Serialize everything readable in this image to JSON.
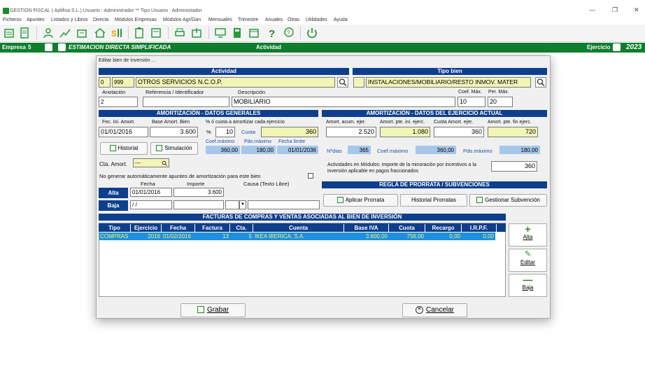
{
  "window": {
    "title": "GESTION FISCAL  ( Aplifisa S.L.)  Usuario : Administrador  **  Tipo Usuario : Administrador"
  },
  "menu": [
    "Ficheros",
    "Apuntes",
    "Listados y Libros",
    "Directa",
    "Módulos Empresas",
    "Módulos Agr/Gan",
    "Mensuales",
    "Trimestre",
    "Anuales",
    "Otras",
    "Utilidades",
    "Ayuda"
  ],
  "status": {
    "empresa_label": "Empresa",
    "empresa_num": "5",
    "regimen": "ESTIMACION DIRECTA SIMPLIFICADA",
    "estado": "Actividad",
    "ejercicio_label": "Ejercicio",
    "ejercicio": "2023"
  },
  "dialog": {
    "title": "Editar bien de Inversión ...",
    "actividad": {
      "header": "Actividad",
      "code1": "0",
      "code2": "999",
      "name": "OTROS SERVICIOS N.C.O.P."
    },
    "tipo_bien": {
      "header": "Tipo bien",
      "name": "INSTALACIONES/MOBILIARIO/RESTO INMOV. MATER"
    },
    "labels": {
      "anotacion": "Anotación",
      "referencia": "Referencia / Identificador",
      "descripcion": "Descripción",
      "coef_max": "Coef. Máx.",
      "per_max": "Per. Máx."
    },
    "values": {
      "anotacion": "2",
      "referencia": "",
      "descripcion": "MOBILIARIO",
      "coef_max": "10",
      "per_max": "20"
    },
    "datos_generales": {
      "header": "AMORTIZACIÓN - DATOS GENERALES",
      "fec_ini_label": "Fec. Ini. Amort.",
      "fec_ini": "01/01/2016",
      "base_label": "Base Amort. Bien",
      "base": "3.600",
      "pct_label": "% ó cuota a amortizar cada ejercicio",
      "pct_symbol": "%",
      "pct": "10",
      "cuota_label": "Cuota",
      "cuota": "360",
      "coef_max_label": "Coef.máximo",
      "coef_max": "360,00",
      "pdo_max_label": "Pdo.máximo",
      "pdo_max": "180,00",
      "fecha_limite_label": "Fecha límite",
      "fecha_limite": "01/01/2036",
      "historial_btn": "Historial",
      "simulacion_btn": "Simulación",
      "cta_amort_label": "Cta. Amort.",
      "cta_amort": "---",
      "no_generar_label": "No generar automáticamente apuntes de amortización para este bien",
      "fecha_col": "Fecha",
      "importe_col": "Importe",
      "causa_col": "Causa (Texto Libre)",
      "alta_label": "Alta",
      "alta_fecha": "01/01/2016",
      "alta_importe": "3.600",
      "baja_label": "Baja",
      "baja_fecha": " / /"
    },
    "datos_ejercicio": {
      "header": "AMORTIZACIÓN - DATOS DEL EJERCICIO ACTUAL",
      "acum_label": "Amort. acum. ejer.",
      "acum": "2.520",
      "pte_ini_label": "Amort. pte. ini. ejerc.",
      "pte_ini": "1.080",
      "cuota_label": "Cuota Amort. ejer.",
      "cuota": "360",
      "pte_fin_label": "Amort. pte. fin ejerc.",
      "pte_fin": "720",
      "ndias_label": "Nºdias",
      "ndias": "365",
      "coef_max_label": "Coef.máximo",
      "coef_max": "360,00",
      "pdo_max_label": "Pdo.máximo",
      "pdo_max": "180,00",
      "modulos_text": "Actividades en Módulos: importe de la minoración por incentivos a la inversión aplicable en pagos fraccionados",
      "modulos_value": "360"
    },
    "prorrata": {
      "header": "REGLA DE PRORRATA / SUBVENCIONES",
      "aplicar_btn": "Aplicar Prorrata",
      "historial_btn": "Historial Prorratas",
      "subvencion_btn": "Gestionar Subvención"
    },
    "facturas": {
      "header": "FACTURAS DE COMPRAS Y VENTAS ASOCIADAS AL BIEN DE INVERSIÓN",
      "columns": [
        "Tipo",
        "Ejercicio",
        "Fecha",
        "Factura",
        "Cta.",
        "Cuenta",
        "Base IVA",
        "Cuota",
        "Recargo",
        "I.R.P.F."
      ],
      "rows": [
        [
          "COMPRAS",
          "2016",
          "01/02/2016",
          "13",
          "5",
          "IKEA IBERICA, S.A.",
          "3.600,00",
          "756,00",
          "0,00",
          "0,00"
        ]
      ],
      "alta_btn": "Alta",
      "editar_btn": "Editar",
      "baja_btn": "Baja"
    },
    "grabar_btn": "Grabar",
    "cancelar_btn": "Cancelar"
  }
}
